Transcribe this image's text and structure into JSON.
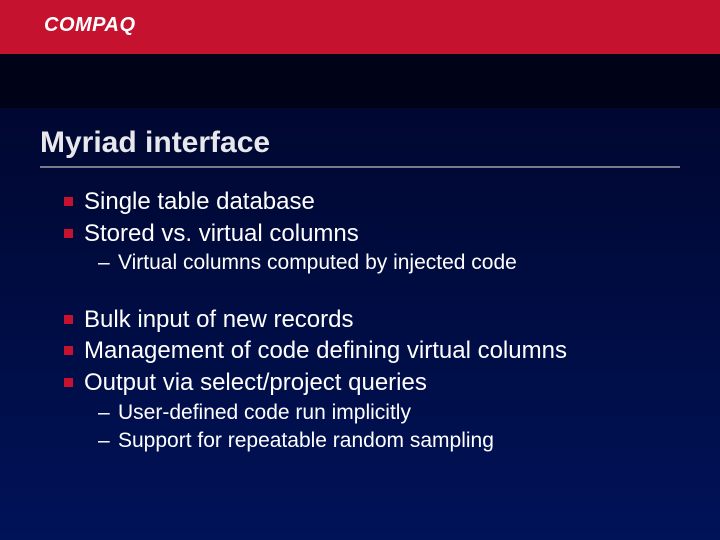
{
  "brand": "COMPAQ",
  "title": "Myriad interface",
  "group1": {
    "items": [
      "Single table database",
      "Stored vs. virtual columns"
    ],
    "sub": [
      "Virtual columns computed by injected code"
    ]
  },
  "group2": {
    "items": [
      "Bulk input of new records",
      "Management of code defining virtual columns",
      "Output via select/project queries"
    ],
    "sub": [
      "User-defined code run implicitly",
      "Support for repeatable random sampling"
    ]
  }
}
